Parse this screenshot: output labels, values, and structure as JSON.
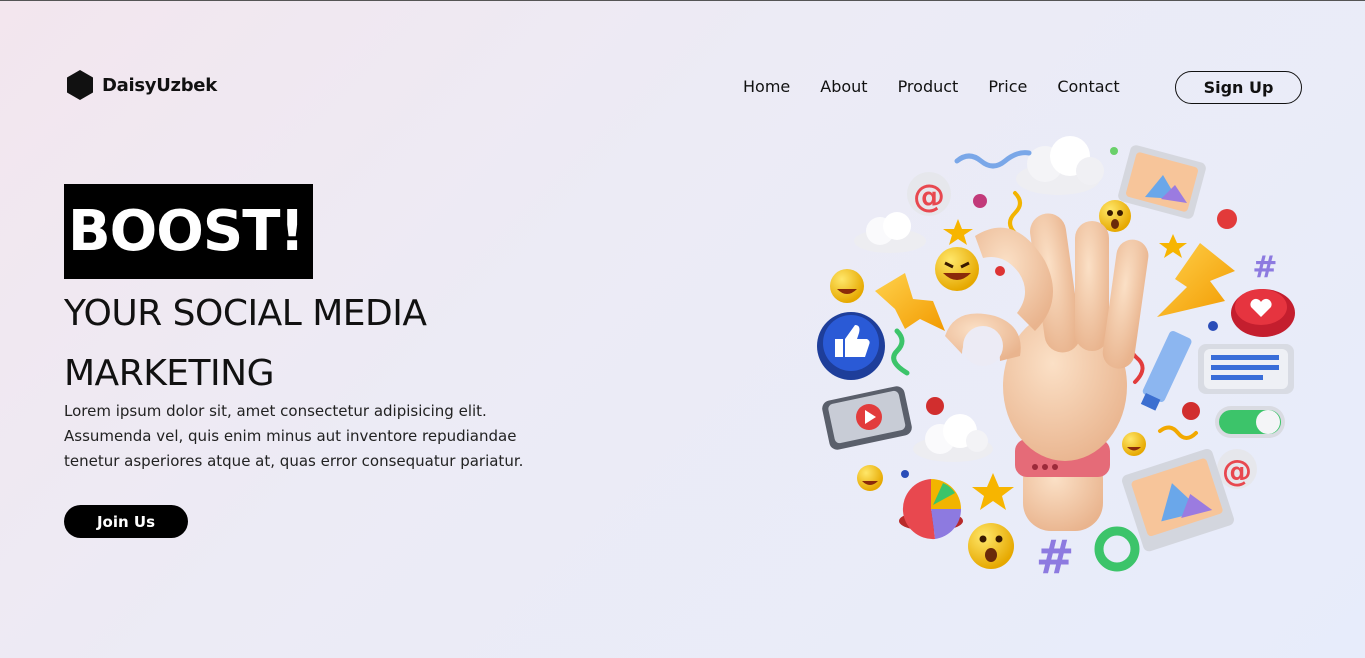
{
  "brand": {
    "name": "DaisyUzbek",
    "logo_icon": "hexagon-icon"
  },
  "nav": {
    "items": [
      "Home",
      "About",
      "Product",
      "Price",
      "Contact"
    ]
  },
  "signup_label": "Sign Up",
  "hero": {
    "highlight": "BOOST!",
    "headline_line1": "YOUR SOCIAL MEDIA",
    "headline_line2": "MARKETING",
    "description": "Lorem ipsum dolor sit, amet consectetur adipisicing elit. Assumenda vel, quis enim minus aut inventore repudiandae tenetur asperiores atque at, quas error consequatur pariatur.",
    "cta": "Join Us"
  },
  "illustration": {
    "name": "social-media-3d-illustration",
    "icons": [
      "ok-hand-icon",
      "cloud-icon",
      "at-sign-icon",
      "like-icon",
      "play-icon",
      "lightning-icon",
      "heart-icon",
      "hashtag-icon",
      "emoji-icon",
      "star-icon",
      "pie-chart-icon",
      "image-icon",
      "chat-icon",
      "toggle-icon"
    ]
  },
  "colors": {
    "text": "#111111",
    "accent_black": "#000000",
    "background_start": "#f3e6ee",
    "background_end": "#e7ecfb"
  }
}
